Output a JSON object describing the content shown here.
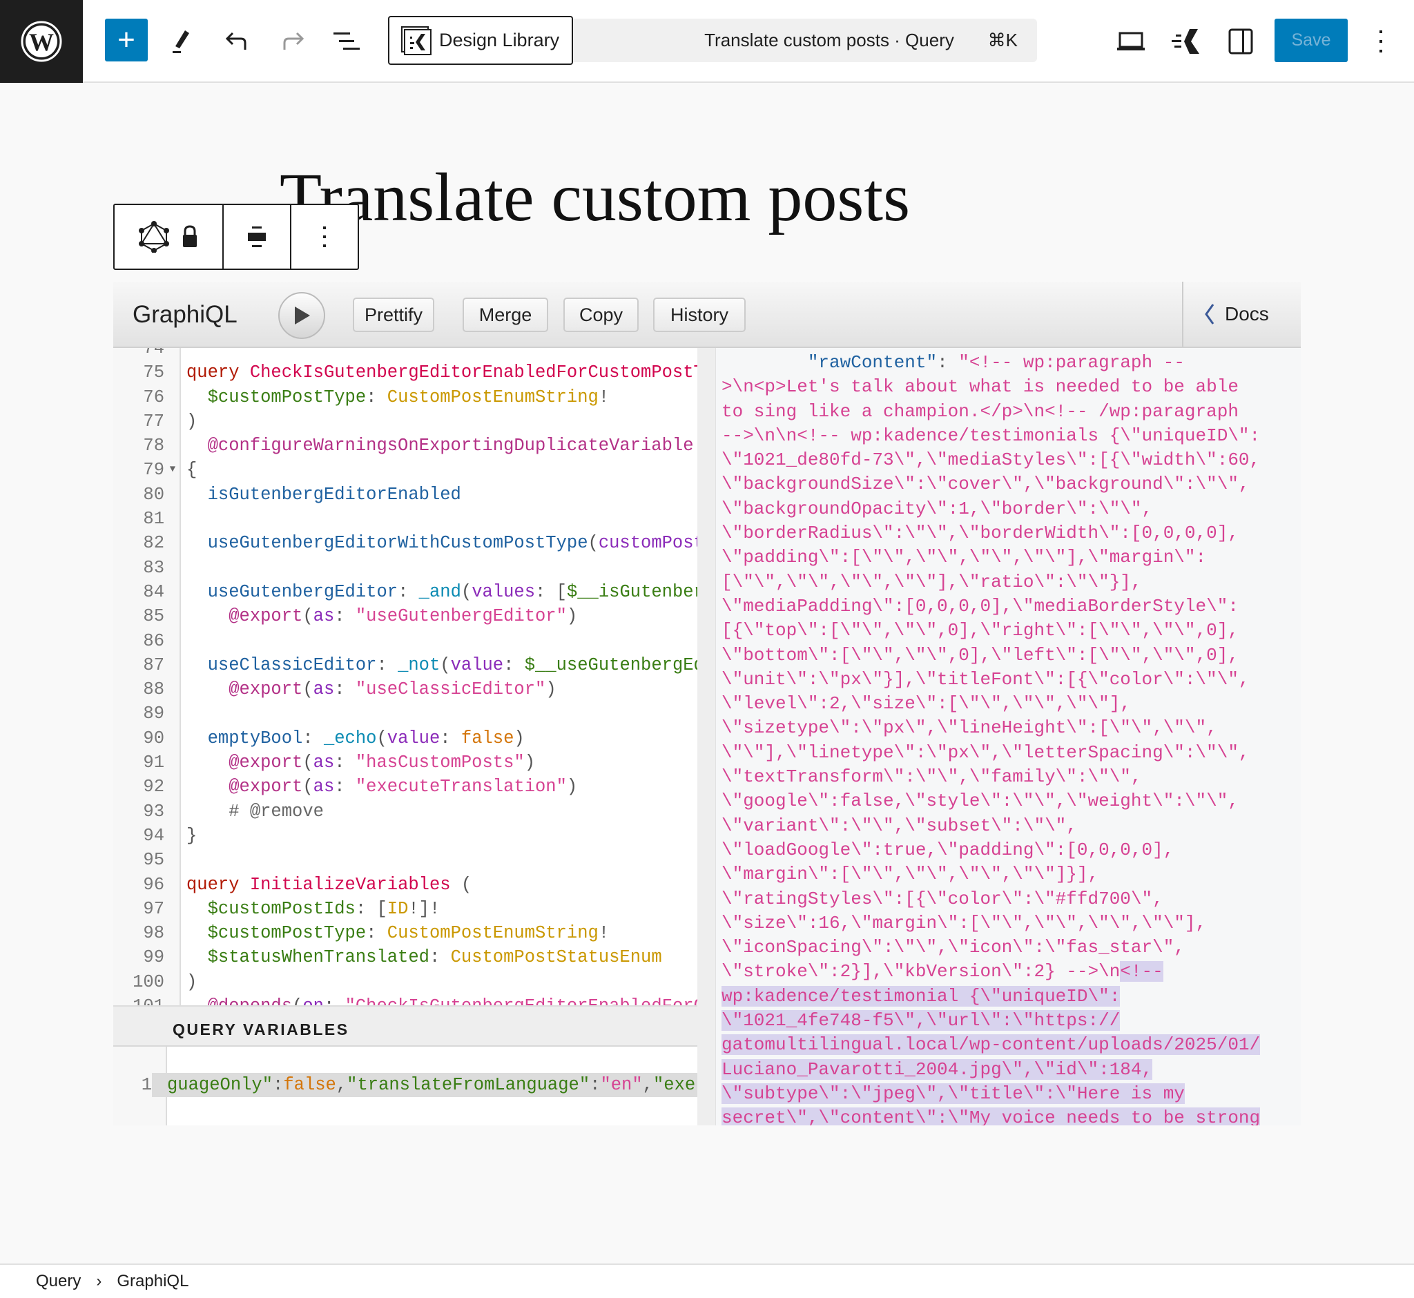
{
  "topbar": {
    "design_library_label": "Design Library",
    "command_title": "Translate custom posts · Query",
    "command_shortcut": "⌘K",
    "save_label": "Save",
    "accent_color": "#007cba"
  },
  "page": {
    "title": "Translate custom posts"
  },
  "graphiql": {
    "logo": "GraphiQL",
    "buttons": [
      "Prettify",
      "Merge",
      "Copy",
      "History"
    ],
    "docs_label": "Docs",
    "query_variables_label": "QUERY VARIABLES",
    "code_lines": [
      {
        "n": "74",
        "t": []
      },
      {
        "n": "75",
        "t": [
          [
            "query",
            "kw"
          ],
          [
            " ",
            "p"
          ],
          [
            "CheckIsGutenbergEditorEnabledForCustomPostType(",
            "def"
          ]
        ]
      },
      {
        "n": "76",
        "t": [
          [
            "  $customPostType",
            "var"
          ],
          [
            ": ",
            "p"
          ],
          [
            "CustomPostEnumString",
            "type"
          ],
          [
            "!",
            "p"
          ]
        ]
      },
      {
        "n": "77",
        "t": [
          [
            ")",
            "p"
          ]
        ]
      },
      {
        "n": "78",
        "t": [
          [
            "  @configureWarningsOnExportingDuplicateVariable",
            "dir"
          ]
        ]
      },
      {
        "n": "79",
        "fold": true,
        "t": [
          [
            "{",
            "p"
          ]
        ]
      },
      {
        "n": "80",
        "t": [
          [
            "  isGutenbergEditorEnabled",
            "prop"
          ]
        ]
      },
      {
        "n": "81",
        "t": []
      },
      {
        "n": "82",
        "t": [
          [
            "  useGutenbergEditorWithCustomPostType",
            "prop"
          ],
          [
            "(",
            "p"
          ],
          [
            "customPostType",
            "arg"
          ]
        ]
      },
      {
        "n": "83",
        "t": []
      },
      {
        "n": "84",
        "t": [
          [
            "  useGutenbergEditor",
            "prop"
          ],
          [
            ": ",
            "p"
          ],
          [
            "_and",
            "fn"
          ],
          [
            "(",
            "p"
          ],
          [
            "values",
            "arg"
          ],
          [
            ": ",
            "p"
          ],
          [
            "[",
            "p"
          ],
          [
            "$__isGutenbergEditorEnabled",
            "var"
          ]
        ]
      },
      {
        "n": "85",
        "t": [
          [
            "    @export",
            "dir"
          ],
          [
            "(",
            "p"
          ],
          [
            "as",
            "arg"
          ],
          [
            ": ",
            "p"
          ],
          [
            "\"useGutenbergEditor\"",
            "str"
          ],
          [
            ")",
            "p"
          ]
        ]
      },
      {
        "n": "86",
        "t": []
      },
      {
        "n": "87",
        "t": [
          [
            "  useClassicEditor",
            "prop"
          ],
          [
            ": ",
            "p"
          ],
          [
            "_not",
            "fn"
          ],
          [
            "(",
            "p"
          ],
          [
            "value",
            "arg"
          ],
          [
            ": ",
            "p"
          ],
          [
            "$__useGutenbergEditor",
            "var"
          ]
        ]
      },
      {
        "n": "88",
        "t": [
          [
            "    @export",
            "dir"
          ],
          [
            "(",
            "p"
          ],
          [
            "as",
            "arg"
          ],
          [
            ": ",
            "p"
          ],
          [
            "\"useClassicEditor\"",
            "str"
          ],
          [
            ")",
            "p"
          ]
        ]
      },
      {
        "n": "89",
        "t": []
      },
      {
        "n": "90",
        "t": [
          [
            "  emptyBool",
            "prop"
          ],
          [
            ": ",
            "p"
          ],
          [
            "_echo",
            "fn"
          ],
          [
            "(",
            "p"
          ],
          [
            "value",
            "arg"
          ],
          [
            ": ",
            "p"
          ],
          [
            "false",
            "bool"
          ],
          [
            ")",
            "p"
          ]
        ]
      },
      {
        "n": "91",
        "t": [
          [
            "    @export",
            "dir"
          ],
          [
            "(",
            "p"
          ],
          [
            "as",
            "arg"
          ],
          [
            ": ",
            "p"
          ],
          [
            "\"hasCustomPosts\"",
            "str"
          ],
          [
            ")",
            "p"
          ]
        ]
      },
      {
        "n": "92",
        "t": [
          [
            "    @export",
            "dir"
          ],
          [
            "(",
            "p"
          ],
          [
            "as",
            "arg"
          ],
          [
            ": ",
            "p"
          ],
          [
            "\"executeTranslation\"",
            "str"
          ],
          [
            ")",
            "p"
          ]
        ]
      },
      {
        "n": "93",
        "t": [
          [
            "    # @remove",
            "cm"
          ]
        ]
      },
      {
        "n": "94",
        "t": [
          [
            "}",
            "p"
          ]
        ]
      },
      {
        "n": "95",
        "t": []
      },
      {
        "n": "96",
        "t": [
          [
            "query",
            "kw"
          ],
          [
            " ",
            "p"
          ],
          [
            "InitializeVariables",
            "def"
          ],
          [
            " (",
            "p"
          ]
        ]
      },
      {
        "n": "97",
        "t": [
          [
            "  $customPostIds",
            "var"
          ],
          [
            ": ",
            "p"
          ],
          [
            "[",
            "p"
          ],
          [
            "ID",
            "type"
          ],
          [
            "!]!",
            "p"
          ]
        ]
      },
      {
        "n": "98",
        "t": [
          [
            "  $customPostType",
            "var"
          ],
          [
            ": ",
            "p"
          ],
          [
            "CustomPostEnumString",
            "type"
          ],
          [
            "!",
            "p"
          ]
        ]
      },
      {
        "n": "99",
        "t": [
          [
            "  $statusWhenTranslated",
            "var"
          ],
          [
            ": ",
            "p"
          ],
          [
            "CustomPostStatusEnum",
            "type"
          ]
        ]
      },
      {
        "n": "100",
        "t": [
          [
            ")",
            "p"
          ]
        ]
      },
      {
        "n": "101",
        "t": [
          [
            "  @depends",
            "dir"
          ],
          [
            "(",
            "p"
          ],
          [
            "on",
            "arg"
          ],
          [
            ": ",
            "p"
          ],
          [
            "\"CheckIsGutenbergEditorEnabledForCustomPostType\"",
            "str"
          ]
        ]
      }
    ],
    "variables_line": {
      "n": "1",
      "t": [
        [
          "guageOnly\"",
          "var"
        ],
        [
          ":",
          "p"
        ],
        [
          "false",
          "bool"
        ],
        [
          ",",
          "p"
        ],
        [
          "\"translateFromLanguage\"",
          "var"
        ],
        [
          ":",
          "p"
        ],
        [
          "\"en\"",
          "str"
        ],
        [
          ",",
          "p"
        ],
        [
          "\"exe",
          "var"
        ]
      ]
    },
    "result_lines": [
      [
        [
          "        \"rawContent\"",
          "rk"
        ],
        [
          ": ",
          "p"
        ],
        [
          "\"<!-- wp:paragraph --",
          ""
        ]
      ],
      [
        [
          ">\\n<p>Let's talk about what is needed to be able",
          ""
        ]
      ],
      [
        [
          "to sing like a champion.</p>\\n<!-- /wp:paragraph",
          ""
        ]
      ],
      [
        [
          "-->\\n\\n<!-- wp:kadence/testimonials {\\\"uniqueID\\\":",
          ""
        ]
      ],
      [
        [
          "\\\"1021_de80fd-73\\\",\\\"mediaStyles\\\":[{\\\"width\\\":60,",
          ""
        ]
      ],
      [
        [
          "\\\"backgroundSize\\\":\\\"cover\\\",\\\"background\\\":\\\"\\\",",
          ""
        ]
      ],
      [
        [
          "\\\"backgroundOpacity\\\":1,\\\"border\\\":\\\"\\\",",
          ""
        ]
      ],
      [
        [
          "\\\"borderRadius\\\":\\\"\\\",\\\"borderWidth\\\":[0,0,0,0],",
          ""
        ]
      ],
      [
        [
          "\\\"padding\\\":[\\\"\\\",\\\"\\\",\\\"\\\",\\\"\\\"],\\\"margin\\\":",
          ""
        ]
      ],
      [
        [
          "[\\\"\\\",\\\"\\\",\\\"\\\",\\\"\\\"],\\\"ratio\\\":\\\"\\\"}],",
          ""
        ]
      ],
      [
        [
          "\\\"mediaPadding\\\":[0,0,0,0],\\\"mediaBorderStyle\\\":",
          ""
        ]
      ],
      [
        [
          "[{\\\"top\\\":[\\\"\\\",\\\"\\\",0],\\\"right\\\":[\\\"\\\",\\\"\\\",0],",
          ""
        ]
      ],
      [
        [
          "\\\"bottom\\\":[\\\"\\\",\\\"\\\",0],\\\"left\\\":[\\\"\\\",\\\"\\\",0],",
          ""
        ]
      ],
      [
        [
          "\\\"unit\\\":\\\"px\\\"}],\\\"titleFont\\\":[{\\\"color\\\":\\\"\\\",",
          ""
        ]
      ],
      [
        [
          "\\\"level\\\":2,\\\"size\\\":[\\\"\\\",\\\"\\\",\\\"\\\"],",
          ""
        ]
      ],
      [
        [
          "\\\"sizetype\\\":\\\"px\\\",\\\"lineHeight\\\":[\\\"\\\",\\\"\\\",",
          ""
        ]
      ],
      [
        [
          "\\\"\\\"],\\\"linetype\\\":\\\"px\\\",\\\"letterSpacing\\\":\\\"\\\",",
          ""
        ]
      ],
      [
        [
          "\\\"textTransform\\\":\\\"\\\",\\\"family\\\":\\\"\\\",",
          ""
        ]
      ],
      [
        [
          "\\\"google\\\":false,\\\"style\\\":\\\"\\\",\\\"weight\\\":\\\"\\\",",
          ""
        ]
      ],
      [
        [
          "\\\"variant\\\":\\\"\\\",\\\"subset\\\":\\\"\\\",",
          ""
        ]
      ],
      [
        [
          "\\\"loadGoogle\\\":true,\\\"padding\\\":[0,0,0,0],",
          ""
        ]
      ],
      [
        [
          "\\\"margin\\\":[\\\"\\\",\\\"\\\",\\\"\\\",\\\"\\\"]}],",
          ""
        ]
      ],
      [
        [
          "\\\"ratingStyles\\\":[{\\\"color\\\":\\\"#ffd700\\\",",
          ""
        ]
      ],
      [
        [
          "\\\"size\\\":16,\\\"margin\\\":[\\\"\\\",\\\"\\\",\\\"\\\",\\\"\\\"],",
          ""
        ]
      ],
      [
        [
          "\\\"iconSpacing\\\":\\\"\\\",\\\"icon\\\":\\\"fas_star\\\",",
          ""
        ]
      ],
      [
        [
          "\\\"stroke\\\":2}],\\\"kbVersion\\\":2} -->\\n",
          ""
        ],
        [
          "<!--",
          "hl"
        ]
      ],
      [
        [
          "wp:kadence/testimonial {\\\"uniqueID\\\":",
          "hl"
        ]
      ],
      [
        [
          "\\\"1021_4fe748-f5\\\",\\\"url\\\":\\\"https://",
          "hl"
        ]
      ],
      [
        [
          "gatomultilingual.local/wp-content/uploads/2025/01/",
          "hl"
        ]
      ],
      [
        [
          "Luciano_Pavarotti_2004.jpg\\\",\\\"id\\\":184,",
          "hl"
        ]
      ],
      [
        [
          "\\\"subtype\\\":\\\"jpeg\\\",\\\"title\\\":\\\"Here is my",
          "hl"
        ]
      ],
      [
        [
          "secret\\\",\\\"content\\\":\\\"My voice needs to be strong",
          "hl"
        ]
      ]
    ]
  },
  "breadcrumb": {
    "items": [
      "Query",
      "GraphiQL"
    ],
    "separator": "›"
  }
}
